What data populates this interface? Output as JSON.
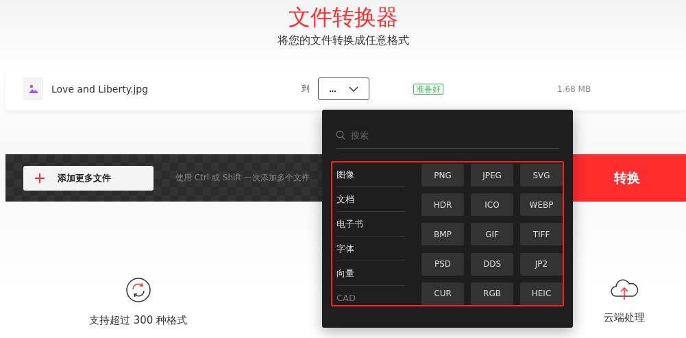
{
  "header": {
    "title": "文件转换器",
    "subtitle": "将您的文件转换成任意格式"
  },
  "file": {
    "name": "Love and Liberty.jpg",
    "to_label": "到",
    "format_select": "...",
    "status": "准备好",
    "size": "1.68 MB"
  },
  "toolbar": {
    "add_button": "添加更多文件",
    "hint": "使用 Ctrl 或 Shift 一次添加多个文件",
    "convert_button": "转换"
  },
  "dropdown": {
    "search_placeholder": "搜索",
    "categories": [
      {
        "label": "图像",
        "dimmed": false
      },
      {
        "label": "文档",
        "dimmed": false
      },
      {
        "label": "电子书",
        "dimmed": false
      },
      {
        "label": "字体",
        "dimmed": false
      },
      {
        "label": "向量",
        "dimmed": false
      },
      {
        "label": "CAD",
        "dimmed": true
      }
    ],
    "formats": [
      "PNG",
      "JPEG",
      "SVG",
      "HDR",
      "ICO",
      "WEBP",
      "BMP",
      "GIF",
      "TIFF",
      "PSD",
      "DDS",
      "JP2",
      "CUR",
      "RGB",
      "HEIC"
    ]
  },
  "features": [
    {
      "kind": "formats",
      "label": "支持超过 300 种格式"
    },
    {
      "kind": "cloud",
      "label": "云端处理"
    }
  ]
}
